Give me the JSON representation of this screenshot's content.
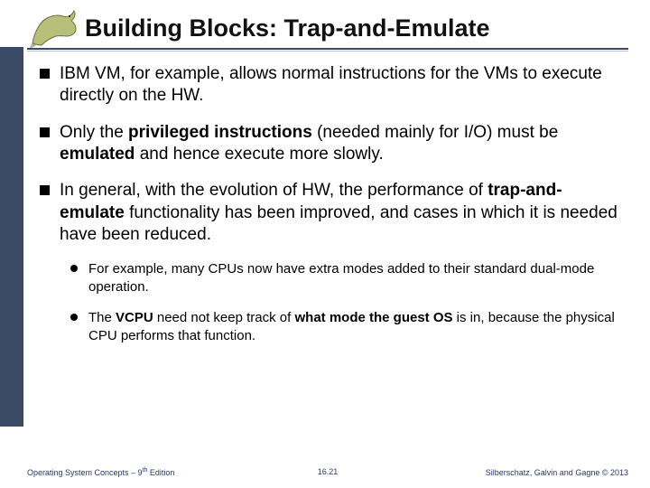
{
  "title": "Building Blocks: Trap-and-Emulate",
  "bullets": [
    {
      "level": 1,
      "html": "IBM VM, for example, allows normal instructions for the VMs to execute directly on the HW."
    },
    {
      "level": 1,
      "html": "Only the <b>privileged instructions</b> (needed mainly for I/O) must be <b>emulated</b> and hence execute more slowly."
    },
    {
      "level": 1,
      "html": "In general, with the evolution of HW, the performance of <b>trap-and-emulate</b> functionality has been improved, and cases in which it is needed have been reduced."
    },
    {
      "level": 2,
      "html": "For example, many CPUs now have extra modes added to their standard dual-mode operation."
    },
    {
      "level": 2,
      "html": "The <b>VCPU</b> need not keep track of <b>what mode the guest OS</b> is in, because the physical CPU performs that function."
    }
  ],
  "footer": {
    "left_html": "Operating System Concepts – 9<sup>th</sup> Edition",
    "center": "16.21",
    "right": "Silberschatz, Galvin and Gagne © 2013"
  }
}
